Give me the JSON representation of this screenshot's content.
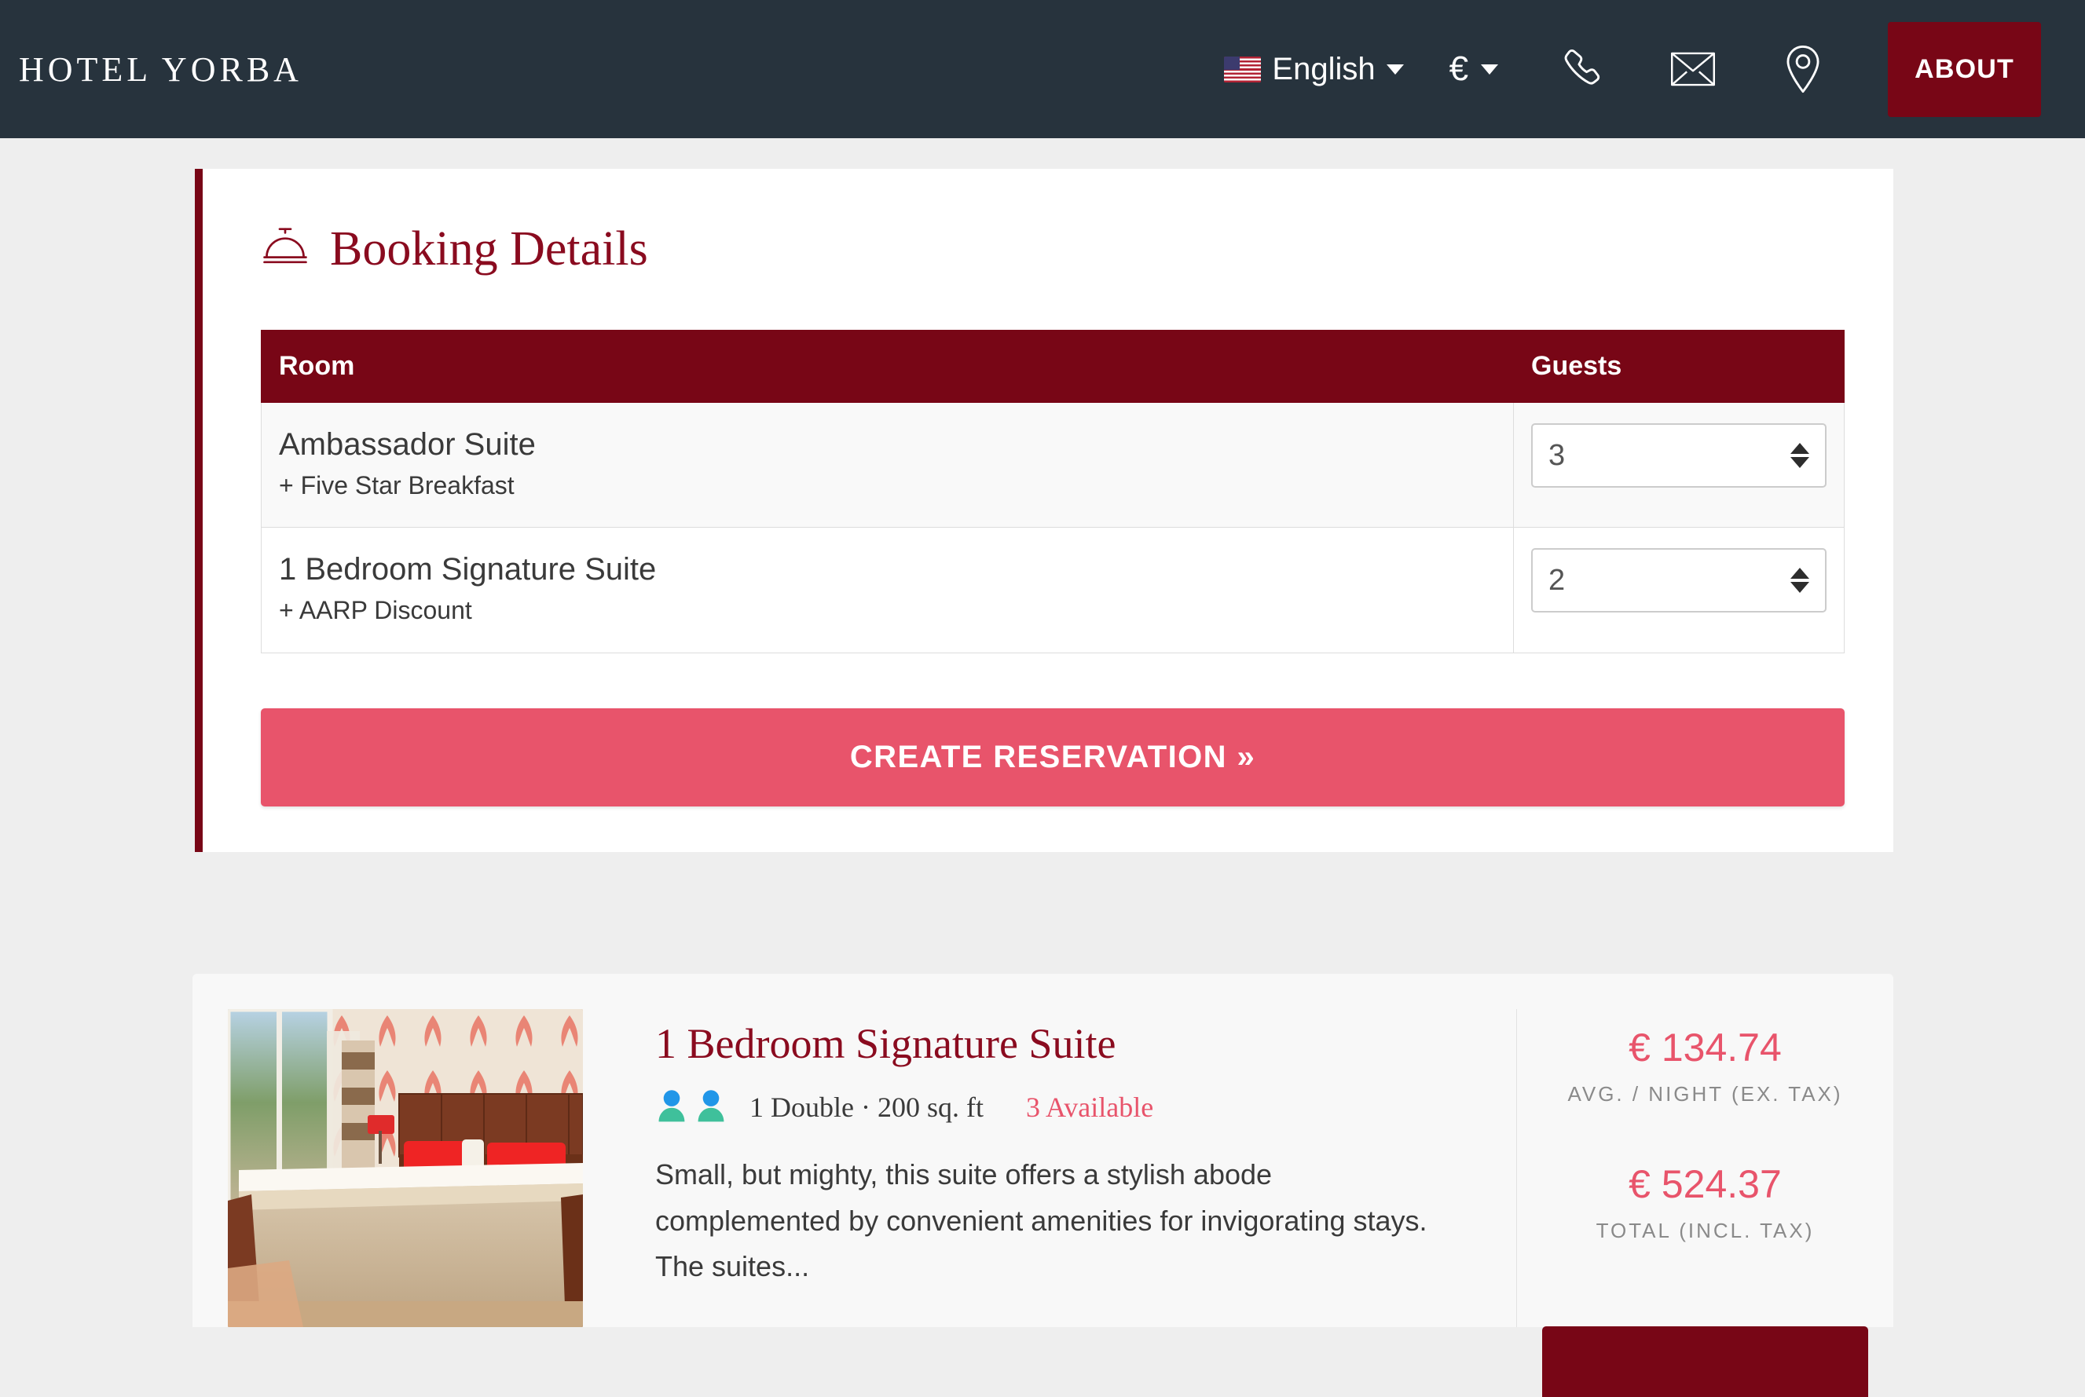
{
  "header": {
    "brand": "HOTEL YORBA",
    "language": {
      "label": "English",
      "flag_icon": "us-flag-icon",
      "caret_icon": "chevron-down-icon"
    },
    "currency": {
      "symbol": "€",
      "caret_icon": "chevron-down-icon"
    },
    "icons": [
      {
        "name": "phone-icon"
      },
      {
        "name": "mail-icon"
      },
      {
        "name": "location-pin-icon"
      }
    ],
    "about_label": "ABOUT",
    "background_color": "#27333d",
    "accent_color": "#780616"
  },
  "booking_panel": {
    "icon": "concierge-bell-icon",
    "title": "Booking Details",
    "accent_color": "#8a0b1f",
    "table": {
      "headers": [
        "Room",
        "Guests"
      ],
      "rows": [
        {
          "room_name": "Ambassador Suite",
          "room_addon": "+ Five Star Breakfast",
          "guests": "3"
        },
        {
          "room_name": "1 Bedroom Signature Suite",
          "room_addon": "+ AARP Discount",
          "guests": "2"
        }
      ]
    },
    "cta_label": "CREATE RESERVATION »",
    "cta_color": "#e8546b"
  },
  "room_card": {
    "photo_alt": "hotel-room-photo",
    "title": "1 Bedroom Signature Suite",
    "occupancy_icons": 2,
    "specs": "1 Double · 200 sq. ft",
    "availability": "3 Available",
    "availability_color": "#e8546b",
    "description": "Small, but mighty, this suite offers a stylish abode complemented by convenient amenities for invigorating stays. The suites...",
    "pricing": {
      "avg_amount": "€ 134.74",
      "avg_label": "AVG. / NIGHT (EX. TAX)",
      "total_amount": "€ 524.37",
      "total_label": "TOTAL (INCL. TAX)",
      "price_color": "#e8546b"
    },
    "book_button_color": "#780616"
  }
}
